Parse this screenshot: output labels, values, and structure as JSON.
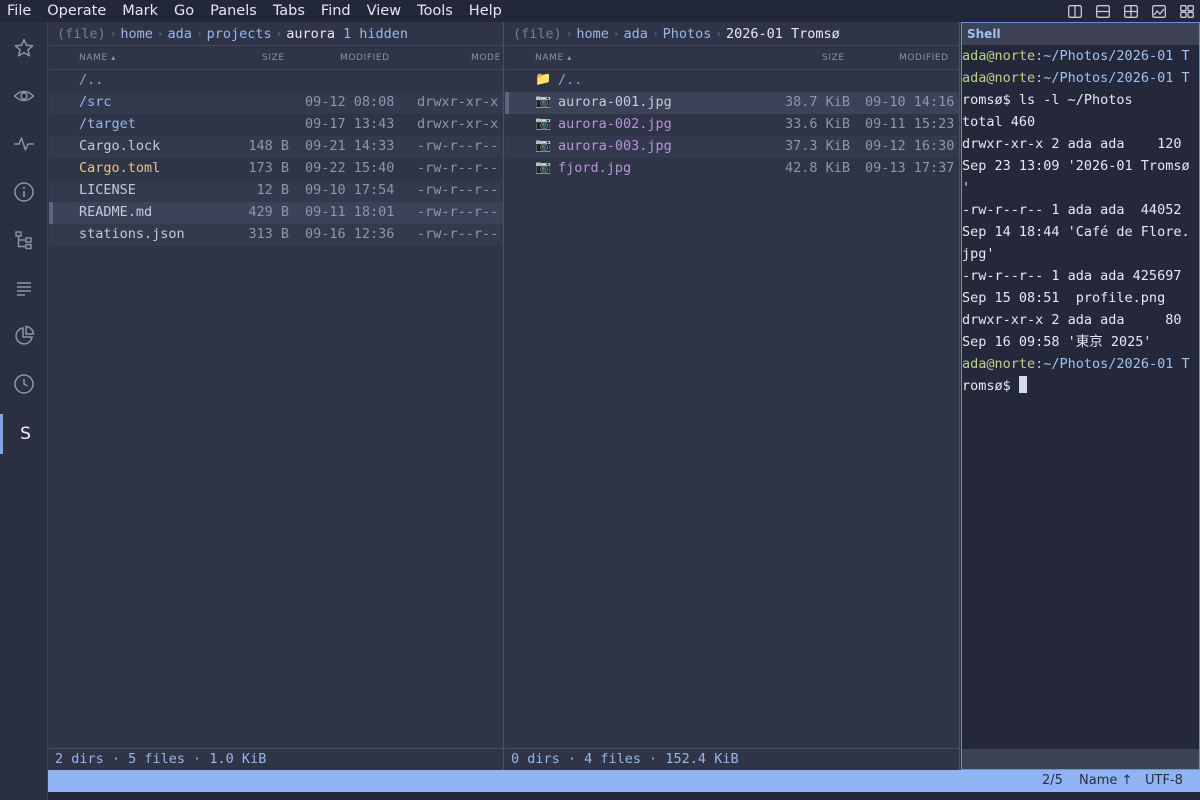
{
  "menu": [
    "File",
    "Operate",
    "Mark",
    "Go",
    "Panels",
    "Tabs",
    "Find",
    "View",
    "Tools",
    "Help"
  ],
  "layout_icons": [
    "layout-split-vertical-icon",
    "layout-split-horizontal-icon",
    "layout-grid-icon",
    "layout-image-icon",
    "layout-quad-icon"
  ],
  "activity": [
    {
      "icon": "star-icon"
    },
    {
      "icon": "eye-icon"
    },
    {
      "icon": "activity-pulse-icon"
    },
    {
      "icon": "info-icon"
    },
    {
      "icon": "tree-icon"
    },
    {
      "icon": "lines-icon"
    },
    {
      "icon": "pie-chart-icon"
    },
    {
      "icon": "clock-icon"
    },
    {
      "label": "S",
      "active": true
    }
  ],
  "left": {
    "crumb": {
      "proto": "(file)",
      "segments": [
        "home",
        "ada",
        "projects"
      ],
      "current": "aurora",
      "hidden": "1 hidden"
    },
    "headers": {
      "name": "NAME",
      "sort": "▴",
      "size": "SIZE",
      "modified": "MODIFIED",
      "mode": "MODE"
    },
    "rows": [
      {
        "name": "/..",
        "kind": "dim",
        "size": "",
        "modified": "",
        "mode": ""
      },
      {
        "name": "/src",
        "kind": "dir",
        "size": "",
        "modified": "09-12 08:08",
        "mode": "drwxr-xr-x"
      },
      {
        "name": "/target",
        "kind": "dir",
        "size": "",
        "modified": "09-17 13:43",
        "mode": "drwxr-xr-x"
      },
      {
        "name": "Cargo.lock",
        "kind": "file",
        "size": "148 B",
        "modified": "09-21 14:33",
        "mode": "-rw-r--r--"
      },
      {
        "name": "Cargo.toml",
        "kind": "cfg",
        "size": "173 B",
        "modified": "09-22 15:40",
        "mode": "-rw-r--r--"
      },
      {
        "name": "LICENSE",
        "kind": "file",
        "size": "12 B",
        "modified": "09-10 17:54",
        "mode": "-rw-r--r--"
      },
      {
        "name": "README.md",
        "kind": "file",
        "size": "429 B",
        "modified": "09-11 18:01",
        "mode": "-rw-r--r--"
      },
      {
        "name": "stations.json",
        "kind": "file",
        "size": "313 B",
        "modified": "09-16 12:36",
        "mode": "-rw-r--r--"
      }
    ],
    "status": "2 dirs · 5 files · 1.0 KiB"
  },
  "right": {
    "crumb": {
      "proto": "(file)",
      "segments": [
        "home",
        "ada",
        "Photos"
      ],
      "current": "2026-01 Tromsø"
    },
    "headers": {
      "name": "NAME",
      "sort": "▴",
      "size": "SIZE",
      "modified": "MODIFIED"
    },
    "rows": [
      {
        "name": "/..",
        "kind": "dim",
        "icon": "📁",
        "size": "",
        "modified": ""
      },
      {
        "name": "aurora-001.jpg",
        "kind": "file",
        "icon": "📷",
        "size": "38.7 KiB",
        "modified": "09-10 14:16"
      },
      {
        "name": "aurora-002.jpg",
        "kind": "img",
        "icon": "📷",
        "size": "33.6 KiB",
        "modified": "09-11 15:23"
      },
      {
        "name": "aurora-003.jpg",
        "kind": "img",
        "icon": "📷",
        "size": "37.3 KiB",
        "modified": "09-12 16:30"
      },
      {
        "name": "fjord.jpg",
        "kind": "img",
        "icon": "📷",
        "size": "42.8 KiB",
        "modified": "09-13 17:37"
      }
    ],
    "status": "0 dirs · 4 files · 152.4 KiB"
  },
  "shell": {
    "title": "Shell",
    "user": "ada@norte",
    "lines": [
      {
        "type": "prompt",
        "path": ":~/Photos/2026-01 T",
        "cmd": ""
      },
      {
        "type": "prompt",
        "path": ":~/Photos/2026-01 T",
        "cmd": ""
      },
      {
        "type": "text",
        "text": "romsø$ ls -l ~/Photos"
      },
      {
        "type": "text",
        "text": "total 460"
      },
      {
        "type": "text",
        "text": "drwxr-xr-x 2 ada ada    120"
      },
      {
        "type": "text",
        "text": "Sep 23 13:09 '2026-01 Tromsø"
      },
      {
        "type": "text",
        "text": "'"
      },
      {
        "type": "text",
        "text": "-rw-r--r-- 1 ada ada  44052"
      },
      {
        "type": "text",
        "text": "Sep 14 18:44 'Café de Flore."
      },
      {
        "type": "text",
        "text": "jpg'"
      },
      {
        "type": "text",
        "text": "-rw-r--r-- 1 ada ada 425697"
      },
      {
        "type": "text",
        "text": "Sep 15 08:51  profile.png"
      },
      {
        "type": "text",
        "text": "drwxr-xr-x 2 ada ada     80"
      },
      {
        "type": "text",
        "text": "Sep 16 09:58 '東京 2025'"
      },
      {
        "type": "prompt",
        "path": ":~/Photos/2026-01 T",
        "cmd": ""
      },
      {
        "type": "cursor",
        "text": "romsø$ "
      }
    ]
  },
  "statusbar": {
    "position": "2/5",
    "sort": "Name ↑",
    "encoding": "UTF-8"
  }
}
